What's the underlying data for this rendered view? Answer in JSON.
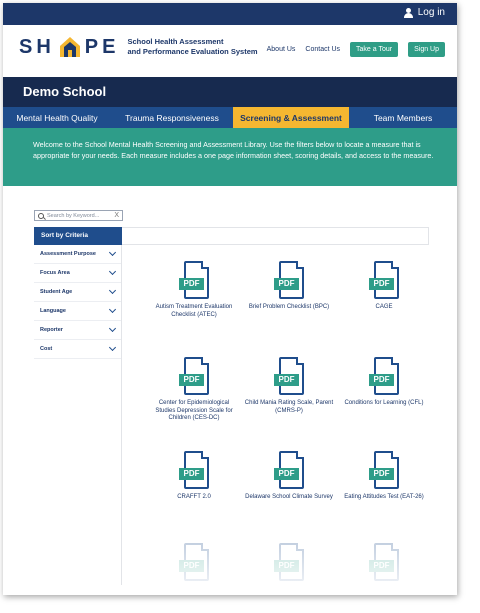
{
  "login": {
    "label": "Log in"
  },
  "logo": {
    "letters_left": "SH",
    "letters_right": "PE",
    "subtitle_line1": "School Health Assessment",
    "subtitle_line2": "and Performance Evaluation System"
  },
  "nav": {
    "about": "About Us",
    "contact": "Contact Us",
    "tour": "Take a Tour",
    "signup": "Sign Up"
  },
  "school_name": "Demo School",
  "tabs": [
    {
      "label": "Mental Health Quality",
      "active": false
    },
    {
      "label": "Trauma Responsiveness",
      "active": false
    },
    {
      "label": "Screening & Assessment",
      "active": true
    },
    {
      "label": "Team Members",
      "active": false
    }
  ],
  "intro_text": "Welcome to the School Mental Health Screening and Assessment Library. Use the filters below to locate a measure that is appropriate for your needs. Each measure includes a one page information sheet, scoring details, and access to the measure.",
  "search": {
    "placeholder": "Search by Keyword...",
    "clear": "X"
  },
  "sort": {
    "header": "Sort by Criteria"
  },
  "criteria": [
    "Assessment Purpose",
    "Focus Area",
    "Student Age",
    "Language",
    "Reporter",
    "Cost"
  ],
  "pdf_badge": "PDF",
  "measures": [
    {
      "label": "Autism Treatment Evaluation Checklist (ATEC)"
    },
    {
      "label": "Brief Problem Checklist (BPC)"
    },
    {
      "label": "CAGE"
    },
    {
      "label": "Center for Epidemiological Studies Depression Scale for Children (CES-DC)"
    },
    {
      "label": "Child Mania Rating Scale, Parent (CMRS-P)"
    },
    {
      "label": "Conditions for Learning (CFL)"
    },
    {
      "label": "CRAFFT 2.0"
    },
    {
      "label": "Delaware School Climate Survey"
    },
    {
      "label": "Eating Attitudes Test (EAT-26)"
    },
    {
      "label": ""
    },
    {
      "label": ""
    },
    {
      "label": ""
    }
  ],
  "colors": {
    "navy": "#1d3769",
    "tab_blue": "#1f4d8c",
    "teal": "#2e9d89",
    "active_tab": "#f5b731"
  }
}
